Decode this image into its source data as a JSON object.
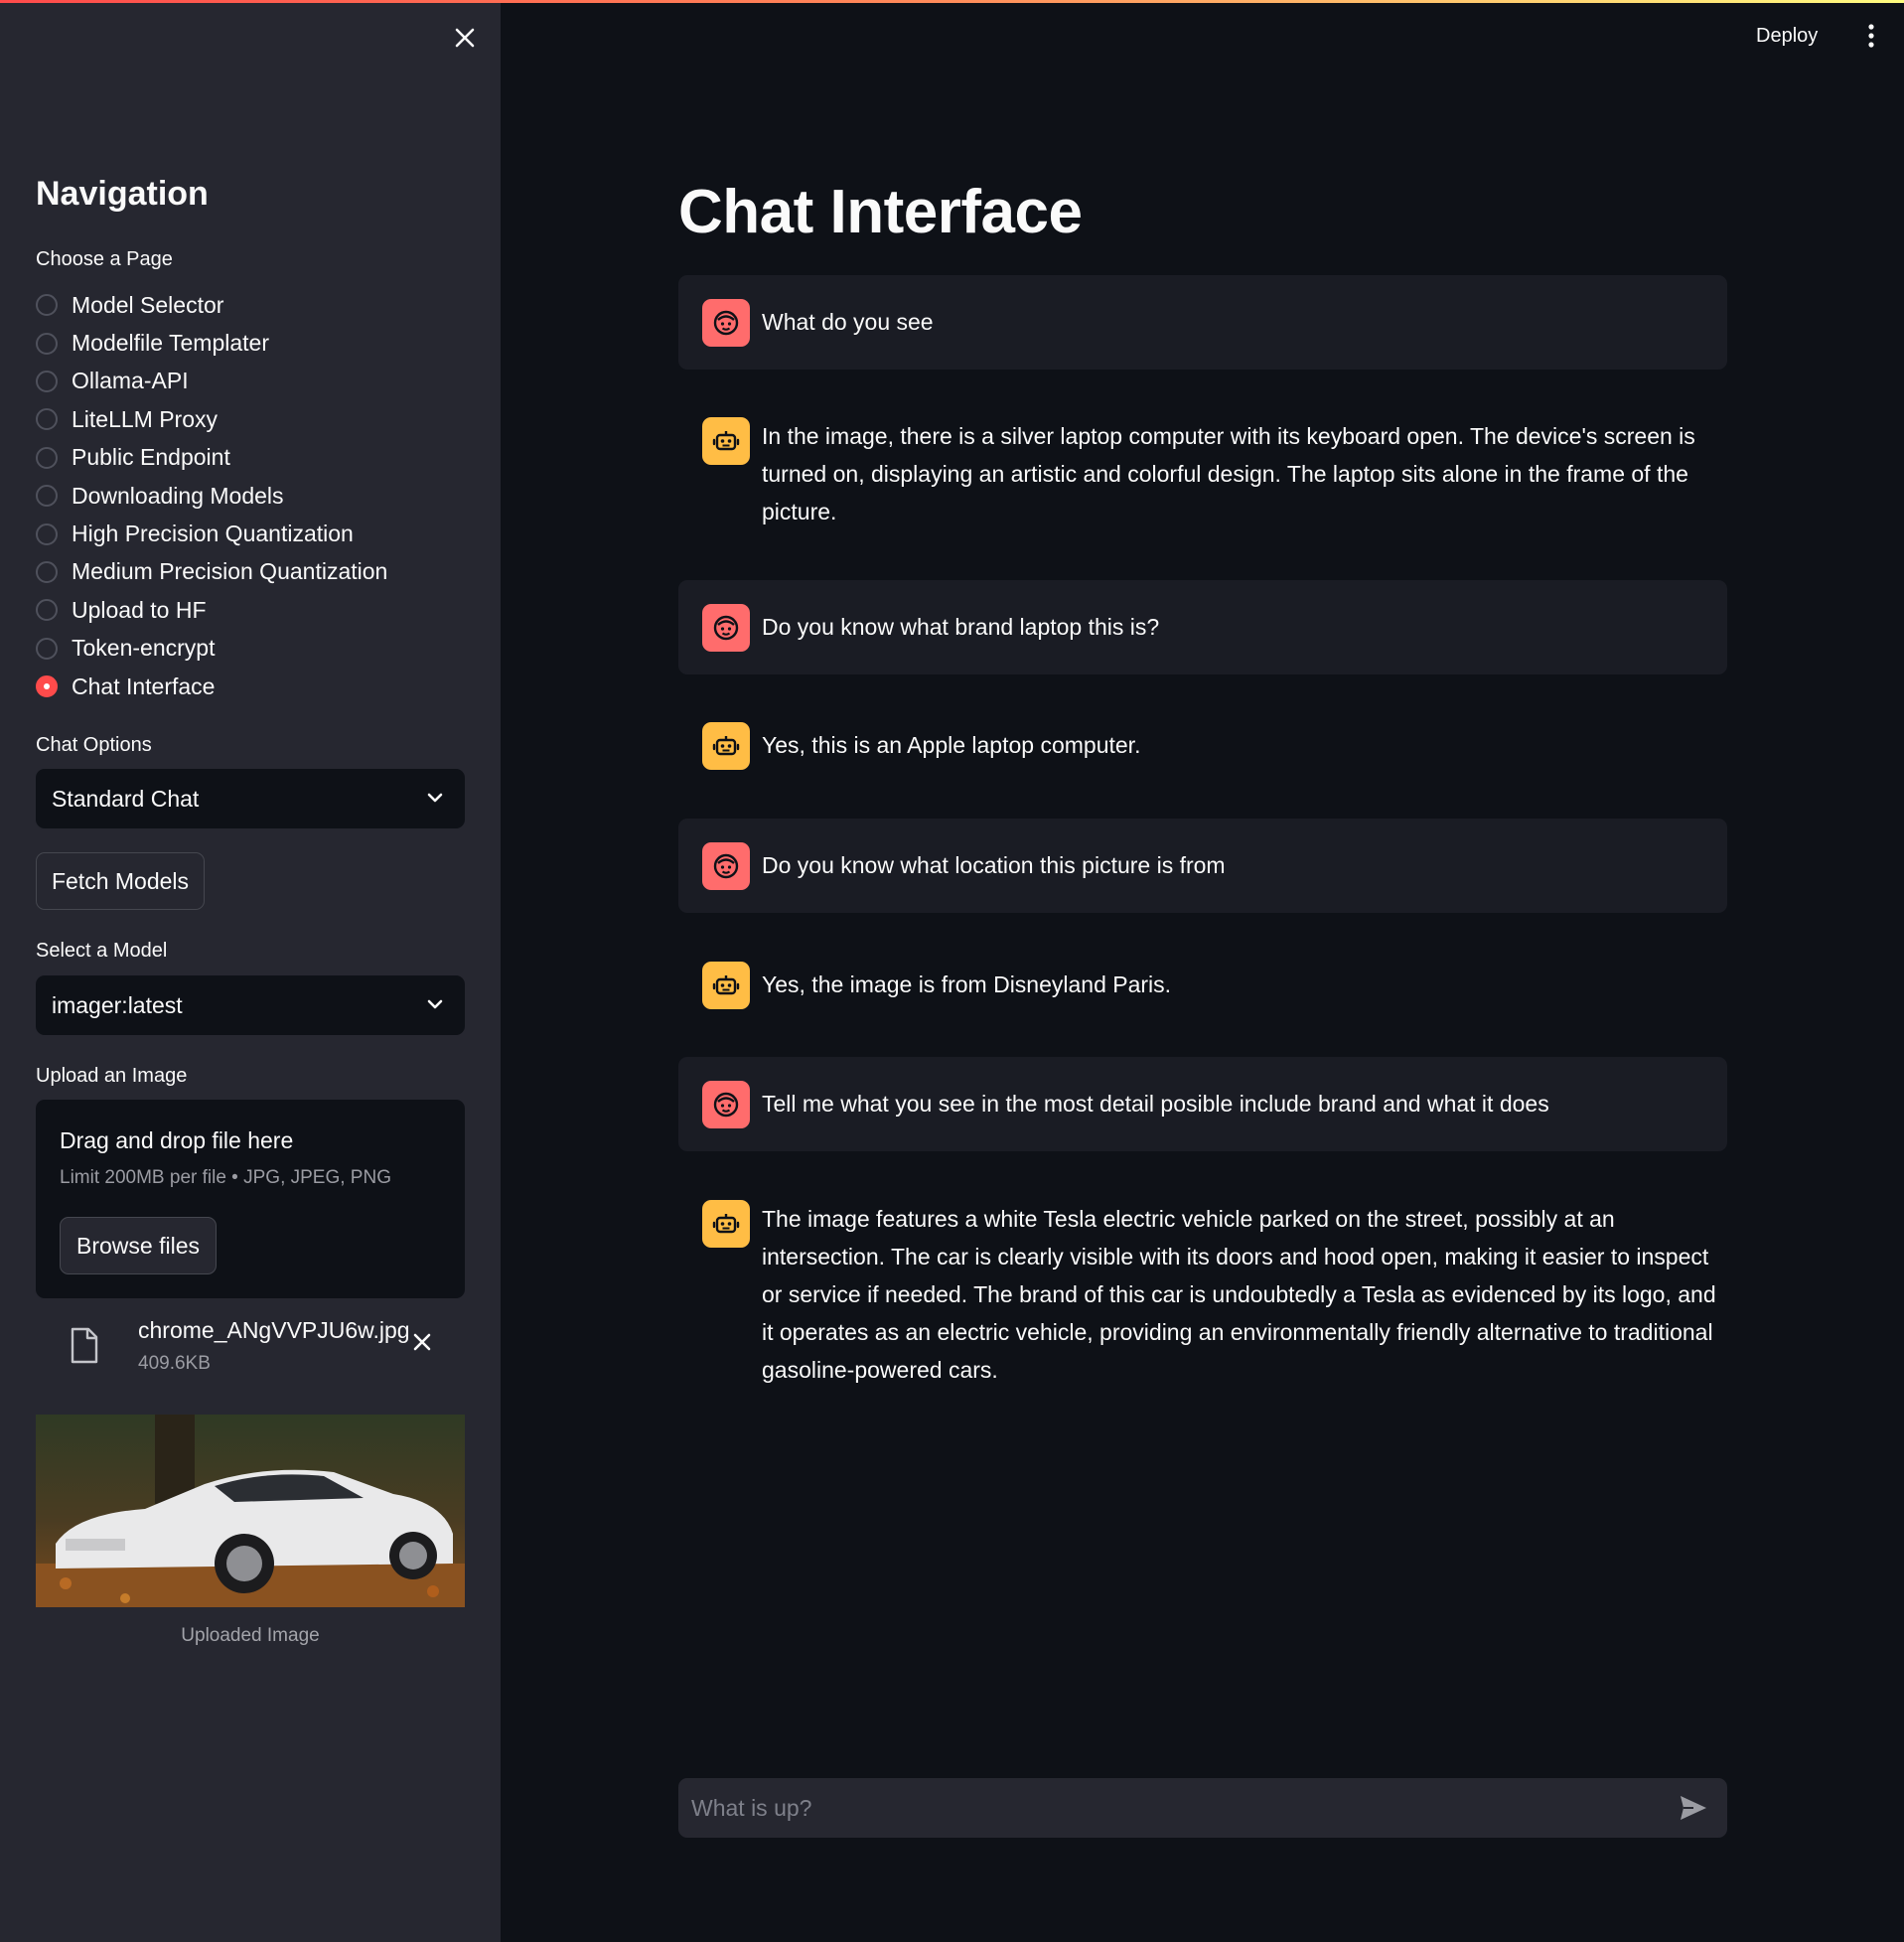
{
  "colors": {
    "accent": "#ff4b4b",
    "user_avatar": "#ff6c6c",
    "bot_avatar": "#ffbd45",
    "sidebar_bg": "#262730",
    "main_bg": "#0e1117"
  },
  "header": {
    "deploy_label": "Deploy",
    "menu_icon": "kebab-menu-icon"
  },
  "sidebar": {
    "close_icon": "close-icon",
    "title": "Navigation",
    "page_label": "Choose a Page",
    "pages": [
      {
        "label": "Model Selector",
        "checked": false
      },
      {
        "label": "Modelfile Templater",
        "checked": false
      },
      {
        "label": "Ollama-API",
        "checked": false
      },
      {
        "label": "LiteLLM Proxy",
        "checked": false
      },
      {
        "label": "Public Endpoint",
        "checked": false
      },
      {
        "label": "Downloading Models",
        "checked": false
      },
      {
        "label": "High Precision Quantization",
        "checked": false
      },
      {
        "label": "Medium Precision Quantization",
        "checked": false
      },
      {
        "label": "Upload to HF",
        "checked": false
      },
      {
        "label": "Token-encrypt",
        "checked": false
      },
      {
        "label": "Chat Interface",
        "checked": true
      }
    ],
    "chat_options_label": "Chat Options",
    "chat_options_value": "Standard Chat",
    "fetch_button": "Fetch Models",
    "model_label": "Select a Model",
    "model_value": "imager:latest",
    "upload_label": "Upload an Image",
    "dropzone_title": "Drag and drop file here",
    "dropzone_limit": "Limit 200MB per file • JPG, JPEG, PNG",
    "browse_button": "Browse files",
    "file_name": "chrome_ANgVVPJU6w.jpg",
    "file_size": "409.6KB",
    "image_caption": "Uploaded Image"
  },
  "main": {
    "title": "Chat Interface",
    "messages": [
      {
        "role": "user",
        "text": "What do you see"
      },
      {
        "role": "assistant",
        "text": "In the image, there is a silver laptop computer with its keyboard open. The device's screen is turned on, displaying an artistic and colorful design. The laptop sits alone in the frame of the picture."
      },
      {
        "role": "user",
        "text": "Do you know what brand laptop this is?"
      },
      {
        "role": "assistant",
        "text": "Yes, this is an Apple laptop computer."
      },
      {
        "role": "user",
        "text": "Do you know what location this picture is from"
      },
      {
        "role": "assistant",
        "text": "Yes, the image is from Disneyland Paris."
      },
      {
        "role": "user",
        "text": "Tell me what you see in the most detail posible include brand and what it does"
      },
      {
        "role": "assistant",
        "text": "The image features a white Tesla electric vehicle parked on the street, possibly at an intersection. The car is clearly visible with its doors and hood open, making it easier to inspect or service if needed. The brand of this car is undoubtedly a Tesla as evidenced by its logo, and it operates as an electric vehicle, providing an environmentally friendly alternative to traditional gasoline-powered cars."
      }
    ],
    "input_placeholder": "What is up?"
  }
}
